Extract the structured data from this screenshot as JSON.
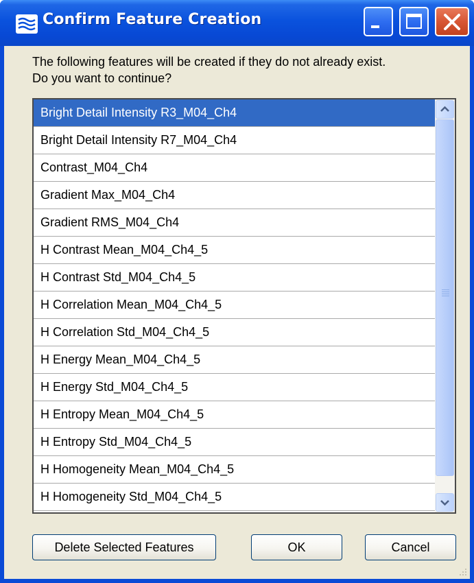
{
  "window": {
    "title": "Confirm Feature Creation",
    "icon": "app-icon"
  },
  "message": {
    "line1": "The following features will be created if they do not already exist.",
    "line2": "Do you want to continue?"
  },
  "list": {
    "selected_index": 0,
    "items": [
      "Bright Detail Intensity R3_M04_Ch4",
      "Bright Detail Intensity R7_M04_Ch4",
      "Contrast_M04_Ch4",
      "Gradient Max_M04_Ch4",
      "Gradient RMS_M04_Ch4",
      "H Contrast Mean_M04_Ch4_5",
      "H Contrast Std_M04_Ch4_5",
      "H Correlation Mean_M04_Ch4_5",
      "H Correlation Std_M04_Ch4_5",
      "H Energy Mean_M04_Ch4_5",
      "H Energy Std_M04_Ch4_5",
      "H Entropy Mean_M04_Ch4_5",
      "H Entropy Std_M04_Ch4_5",
      "H Homogeneity Mean_M04_Ch4_5",
      "H Homogeneity Std_M04_Ch4_5"
    ]
  },
  "buttons": {
    "delete_label": "Delete Selected Features",
    "ok_label": "OK",
    "cancel_label": "Cancel"
  },
  "colors": {
    "titlebar": "#0a52dd",
    "selection": "#316ac5",
    "dialog_bg": "#ece9d8"
  }
}
